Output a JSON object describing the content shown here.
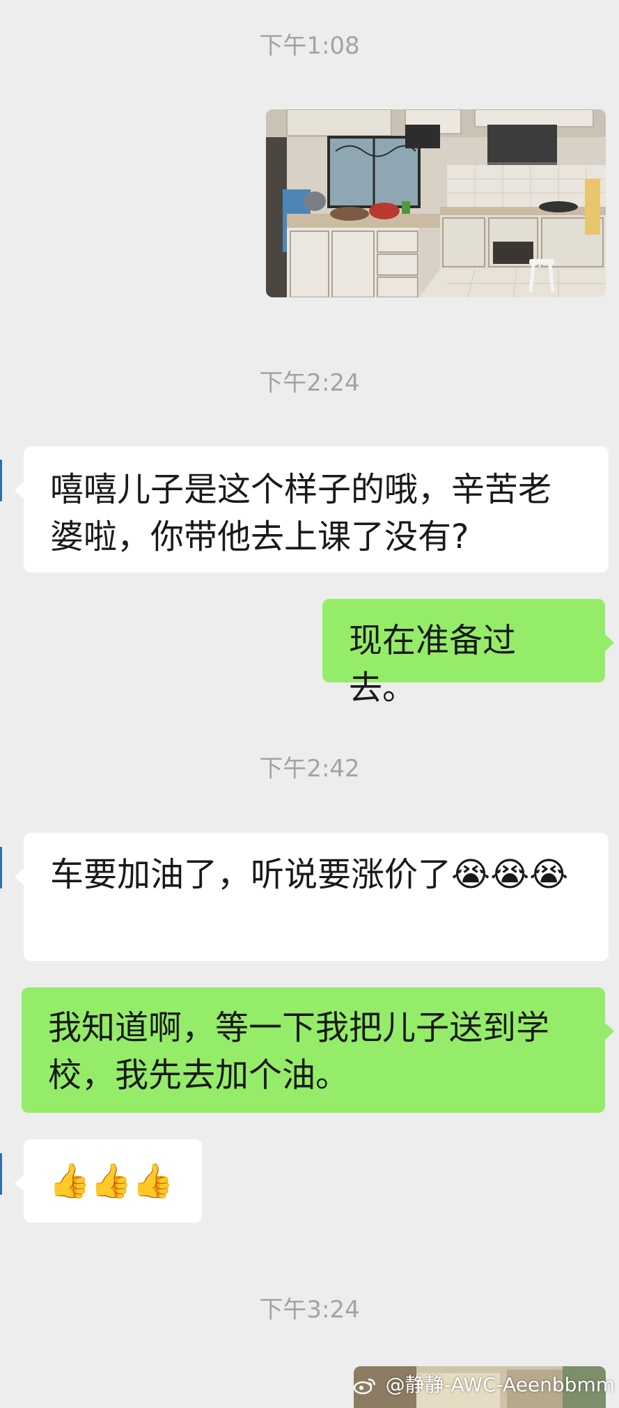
{
  "timestamps": [
    "下午1:08",
    "下午2:24",
    "下午2:42",
    "下午3:24"
  ],
  "messages": {
    "m1": "嘻嘻儿子是这个样子的哦，辛苦老婆啦，你带他去上课了没有?",
    "m2": "现在准备过去。",
    "m3": "车要加油了，听说要涨价了😭😭😭",
    "m4": "我知道啊，等一下我把儿子送到学校，我先去加个油。",
    "m5": "👍👍👍"
  },
  "watermark": "@静静-AWC-Aeenbbmm",
  "colors": {
    "background": "#ededed",
    "incoming_bubble": "#ffffff",
    "outgoing_bubble": "#95ec69",
    "timestamp_text": "#a3a3a3"
  },
  "icons": {
    "kitchen_photo": "kitchen-photo",
    "second_photo": "food-photo",
    "watermark_logo": "weibo-logo-icon"
  }
}
